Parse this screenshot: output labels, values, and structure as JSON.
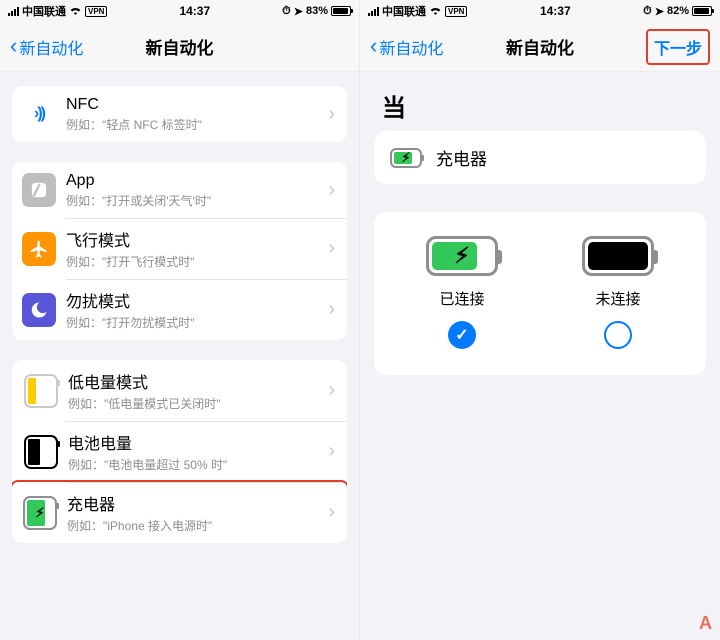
{
  "left": {
    "status": {
      "carrier": "中国联通",
      "vpn": "VPN",
      "time": "14:37",
      "battery_text": "83%",
      "battery_pct": 83
    },
    "nav": {
      "back": "新自动化",
      "title": "新自动化"
    },
    "groups": [
      {
        "rows": [
          {
            "id": "nfc",
            "title": "NFC",
            "subtitle": "例如：\"轻点 NFC 标签时\""
          }
        ]
      },
      {
        "rows": [
          {
            "id": "app",
            "title": "App",
            "subtitle": "例如：\"打开或关闭'天气'时\""
          },
          {
            "id": "airplane",
            "title": "飞行模式",
            "subtitle": "例如：\"打开飞行模式时\""
          },
          {
            "id": "dnd",
            "title": "勿扰模式",
            "subtitle": "例如：\"打开勿扰模式时\""
          }
        ]
      },
      {
        "rows": [
          {
            "id": "lowpower",
            "title": "低电量模式",
            "subtitle": "例如：\"低电量模式已关闭时\""
          },
          {
            "id": "level",
            "title": "电池电量",
            "subtitle": "例如：\"电池电量超过 50% 时\""
          },
          {
            "id": "charger",
            "title": "充电器",
            "subtitle": "例如：\"iPhone 接入电源时\"",
            "highlighted": true
          }
        ]
      }
    ]
  },
  "right": {
    "status": {
      "carrier": "中国联通",
      "vpn": "VPN",
      "time": "14:37",
      "battery_text": "82%",
      "battery_pct": 82
    },
    "nav": {
      "back": "新自动化",
      "title": "新自动化",
      "next": "下一步",
      "next_highlighted": true
    },
    "section_label": "当",
    "card_label": "充电器",
    "options": {
      "connected": {
        "label": "已连接",
        "selected": true
      },
      "disconnected": {
        "label": "未连接",
        "selected": false
      }
    }
  },
  "watermark": "A"
}
